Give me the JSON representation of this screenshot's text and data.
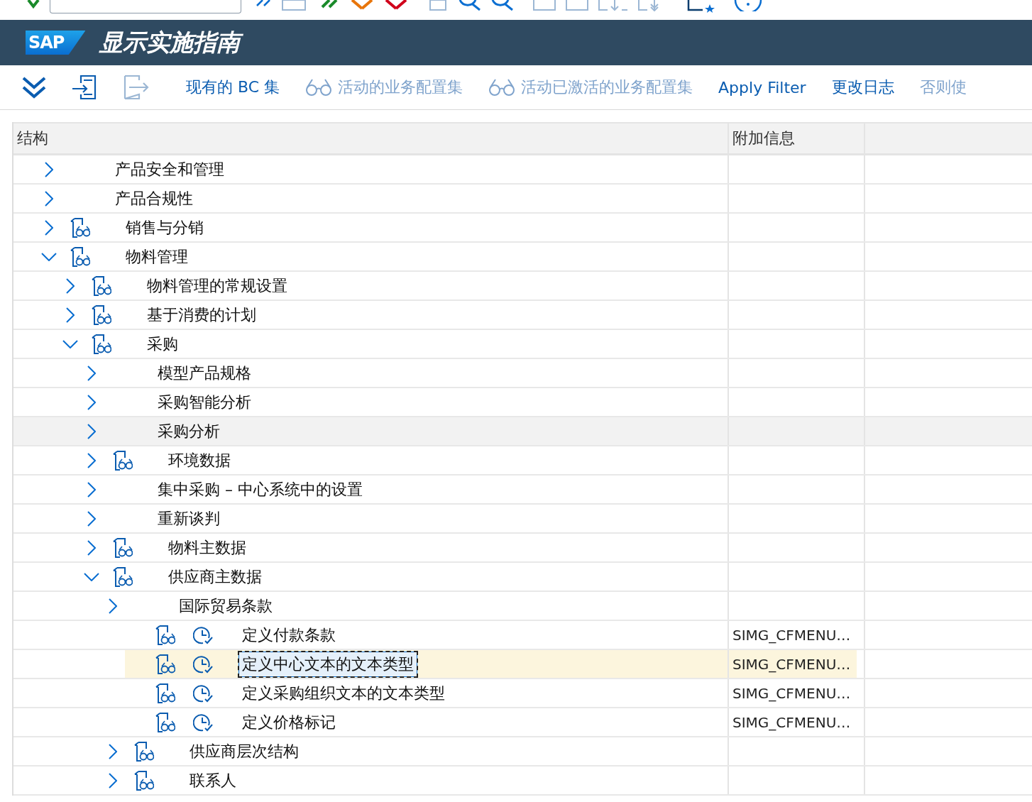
{
  "window": {
    "logo": "SAP",
    "title": "显示实施指南"
  },
  "toolbar": {
    "icon_buttons": [
      {
        "kind": "expand-all",
        "disabled": false
      },
      {
        "kind": "import",
        "disabled": false
      },
      {
        "kind": "transfer",
        "disabled": true
      }
    ],
    "buttons": [
      {
        "label": "现有的 BC 集",
        "kind": "plain",
        "disabled": false
      },
      {
        "label": "活动的业务配置集",
        "kind": "glasses",
        "disabled": true
      },
      {
        "label": "活动已激活的业务配置集",
        "kind": "glasses",
        "disabled": true
      },
      {
        "label": "Apply Filter",
        "kind": "plain",
        "disabled": false
      },
      {
        "label": "更改日志",
        "kind": "plain",
        "disabled": false
      },
      {
        "label": "否则使",
        "kind": "plain",
        "disabled": true
      }
    ]
  },
  "table": {
    "columns": [
      "结构",
      "附加信息"
    ],
    "rows": [
      {
        "label": "产品安全和管理",
        "kind": "folder",
        "expanded": false,
        "selected": false,
        "highlighted": false
      },
      {
        "label": "产品合规性",
        "kind": "folder",
        "expanded": false,
        "selected": false,
        "highlighted": false
      },
      {
        "label": "销售与分销",
        "kind": "doc",
        "expanded": false,
        "selected": false,
        "highlighted": false
      },
      {
        "label": "物料管理",
        "kind": "doc",
        "expanded": true,
        "selected": false,
        "highlighted": false,
        "children": [
          {
            "label": "物料管理的常规设置",
            "kind": "doc",
            "expanded": false,
            "selected": false,
            "highlighted": false
          },
          {
            "label": "基于消费的计划",
            "kind": "doc",
            "expanded": false,
            "selected": false,
            "highlighted": false
          },
          {
            "label": "采购",
            "kind": "doc",
            "expanded": true,
            "selected": false,
            "highlighted": false,
            "children": [
              {
                "label": "模型产品规格",
                "kind": "folder",
                "expanded": false,
                "selected": false,
                "highlighted": false
              },
              {
                "label": "采购智能分析",
                "kind": "folder",
                "expanded": false,
                "selected": false,
                "highlighted": false
              },
              {
                "label": "采购分析",
                "kind": "folder",
                "expanded": false,
                "selected": false,
                "highlighted": true
              },
              {
                "label": "环境数据",
                "kind": "doc",
                "expanded": false,
                "selected": false,
                "highlighted": false
              },
              {
                "label": "集中采购 – 中心系统中的设置",
                "kind": "folder",
                "expanded": false,
                "selected": false,
                "highlighted": false
              },
              {
                "label": "重新谈判",
                "kind": "folder",
                "expanded": false,
                "selected": false,
                "highlighted": false
              },
              {
                "label": "物料主数据",
                "kind": "doc",
                "expanded": false,
                "selected": false,
                "highlighted": false
              },
              {
                "label": "供应商主数据",
                "kind": "doc",
                "expanded": true,
                "selected": false,
                "highlighted": false,
                "children": [
                  {
                    "label": "国际贸易条款",
                    "kind": "folder",
                    "expanded": false,
                    "selected": false,
                    "highlighted": false
                  },
                  {
                    "label": "定义付款条款",
                    "kind": "activity",
                    "info": "SIMG_CFMENU…",
                    "selected": false,
                    "highlighted": false
                  },
                  {
                    "label": "定义中心文本的文本类型",
                    "kind": "activity",
                    "info": "SIMG_CFMENU…",
                    "selected": true,
                    "highlighted": false
                  },
                  {
                    "label": "定义采购组织文本的文本类型",
                    "kind": "activity",
                    "info": "SIMG_CFMENU…",
                    "selected": false,
                    "highlighted": false
                  },
                  {
                    "label": "定义价格标记",
                    "kind": "activity",
                    "info": "SIMG_CFMENU…",
                    "selected": false,
                    "highlighted": false
                  },
                  {
                    "label": "供应商层次结构",
                    "kind": "doc",
                    "expanded": false,
                    "selected": false,
                    "highlighted": false
                  },
                  {
                    "label": "联系人",
                    "kind": "doc",
                    "expanded": false,
                    "selected": false,
                    "highlighted": false
                  }
                ]
              }
            ]
          }
        ]
      }
    ]
  }
}
